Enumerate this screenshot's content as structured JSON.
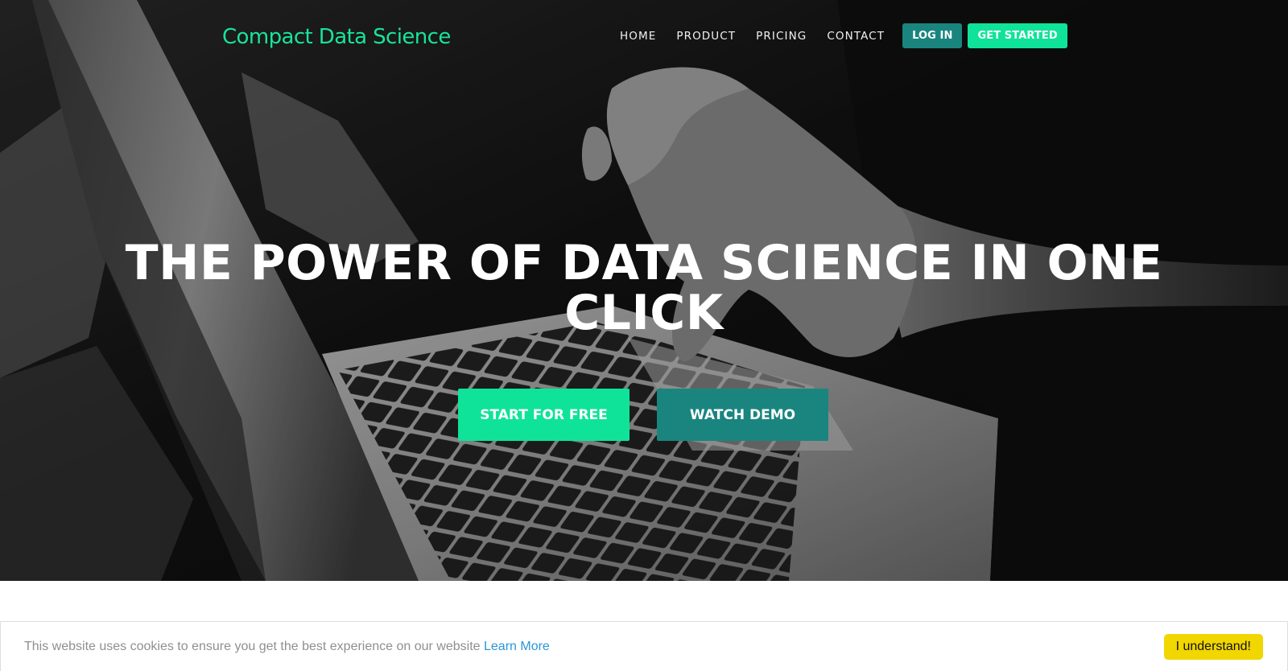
{
  "header": {
    "brand": "Compact Data Science",
    "nav": [
      "HOME",
      "PRODUCT",
      "PRICING",
      "CONTACT"
    ],
    "login_label": "LOG IN",
    "get_started_label": "GET STARTED"
  },
  "hero": {
    "headline": "THE POWER OF DATA SCIENCE IN ONE CLICK",
    "cta_primary": "START FOR FREE",
    "cta_secondary": "WATCH DEMO"
  },
  "cookie": {
    "message": "This website uses cookies to ensure you get the best experience on our website",
    "link_label": "Learn More",
    "accept_label": "I understand!"
  },
  "colors": {
    "brand_green": "#19e39a",
    "teal": "#1a857f",
    "cookie_button": "#f1d600",
    "cookie_link": "#2b96d8"
  }
}
